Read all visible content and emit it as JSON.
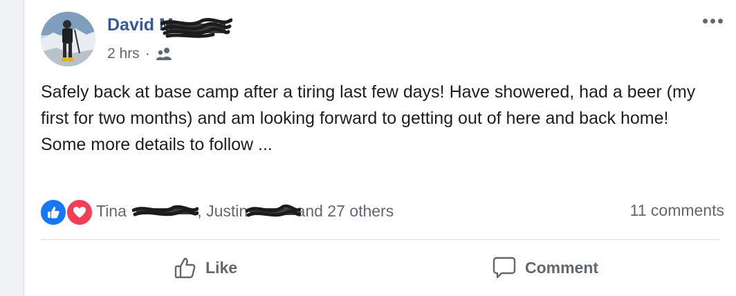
{
  "post": {
    "author": "David M",
    "time": "2 hrs",
    "separator": "·",
    "audience_icon": "friends-icon",
    "more_icon": "more-options-icon",
    "text_lines": [
      "Safely back at base camp after a tiring last few days! Have showered, had a beer (my first for two months) and am looking forward to getting out of here and back home!",
      "Some more details to follow ..."
    ]
  },
  "reactions": {
    "icons": [
      "like-reaction-icon",
      "love-reaction-icon"
    ],
    "name1": "Tina",
    "comma": ",",
    "name2": "Justin",
    "others": "and 27 others",
    "comments": "11 comments"
  },
  "actions": {
    "like_label": "Like",
    "comment_label": "Comment"
  },
  "colors": {
    "author": "#385898",
    "text": "#1c1e21",
    "secondary": "#606770",
    "like_blue": "#1877f2",
    "love_red": "#f33e58"
  }
}
